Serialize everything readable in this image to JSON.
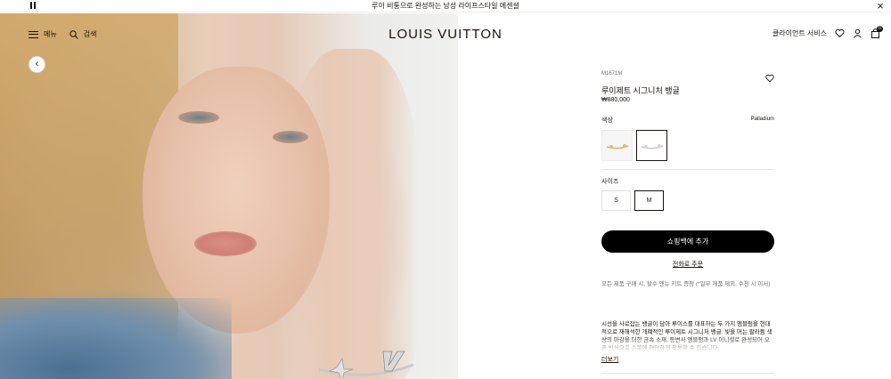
{
  "announcement": {
    "text": "루이 비통으로 완성하는 남성 라이프스타일 에센셜"
  },
  "header": {
    "menu_label": "메뉴",
    "search_label": "검색",
    "logo": "LOUIS VUITTON",
    "client_service": "클라이언트 서비스",
    "cart_count": "0"
  },
  "product": {
    "sku": "M1671M",
    "name": "루이제트 시그니처 뱅글",
    "price": "₩880,000",
    "color_label": "색상",
    "color_value": "Palladium",
    "size_label": "사이즈",
    "sizes": [
      "S",
      "M"
    ],
    "selected_size": "M",
    "add_to_bag": "쇼핑백에 추가",
    "order_link": "전화로 주문",
    "notice": "모든 제품 구매 시, 할수 엔뉴 키트 증정 (*일부 제품 제외, 수전 시 이서)",
    "description": "시선을 사로잡는 뱅글이 담아 루이스를 대표하는 두 가지 엠블럼을 현대적으로 재해석한 개폐적인 루이제트 시그니처 뱅글. 빛을 머는 팔라듐 색상의 마감을 더한 금속 소재, 등변사 엠블럼과 LV 이니셜로 완성되어 오픈 방식으로 손목에 편안하게 착용할 수 있습니다.",
    "more_label": "더보기"
  },
  "colors": {
    "accent": "#19110b",
    "cta_bg": "#000000",
    "cta_text": "#ffffff"
  }
}
